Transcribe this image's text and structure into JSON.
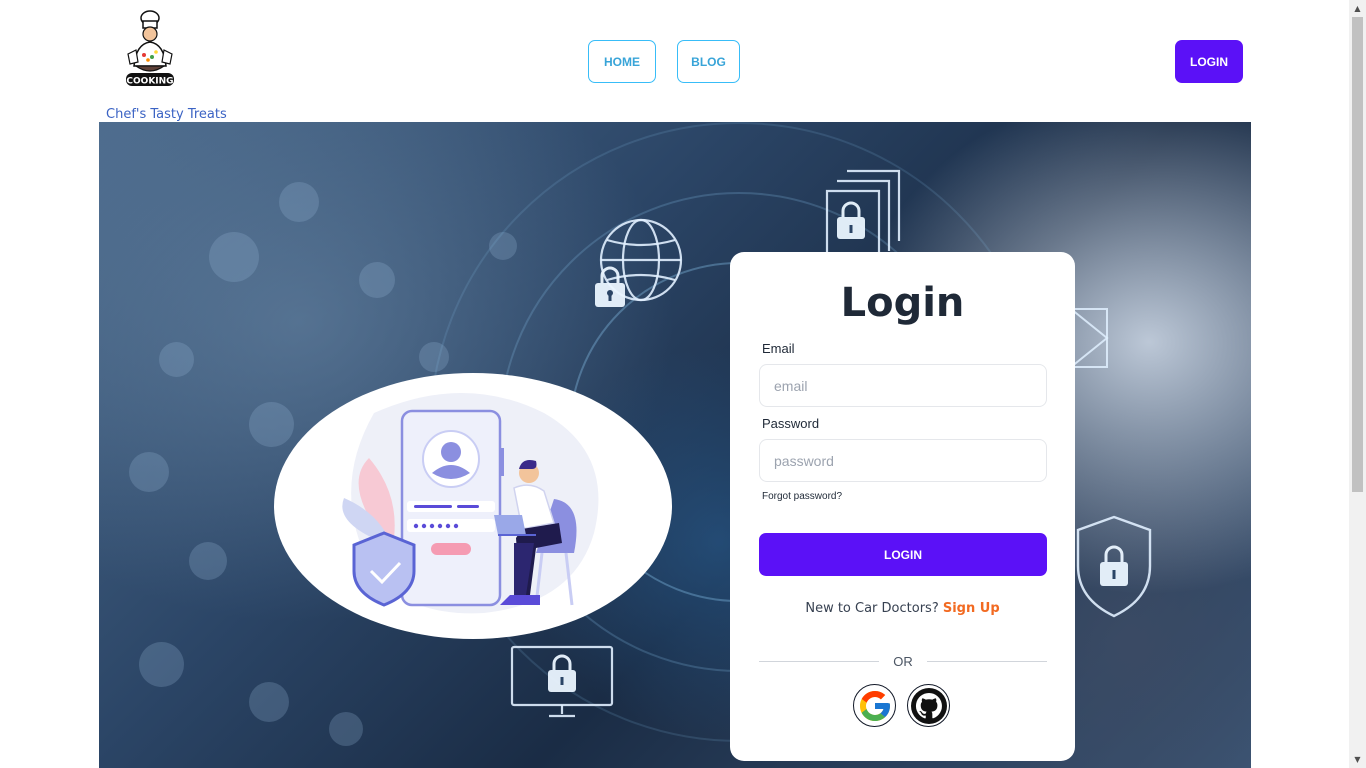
{
  "brand": {
    "name": "Chef's Tasty Treats",
    "logo_text": "COOKING",
    "logo_icon": "chef-logo-icon"
  },
  "nav": {
    "items": [
      {
        "label": "HOME"
      },
      {
        "label": "BLOG"
      }
    ],
    "login_label": "LOGIN"
  },
  "colors": {
    "accent": "#5b11f7",
    "nav_border": "#38bdf8",
    "signup_link": "#f26a21",
    "brand_text": "#3b63c4"
  },
  "login_form": {
    "title": "Login",
    "email": {
      "label": "Email",
      "placeholder": "email",
      "value": ""
    },
    "password": {
      "label": "Password",
      "placeholder": "password",
      "value": ""
    },
    "forgot_password": "Forgot password?",
    "submit_label": "LOGIN",
    "signup_prompt": "New to Car Doctors?",
    "signup_link": "Sign Up",
    "divider_text": "OR",
    "social": [
      {
        "name": "google",
        "icon": "google-icon"
      },
      {
        "name": "github",
        "icon": "github-icon"
      }
    ]
  },
  "hero": {
    "background_icons": [
      "globe-lock-icon",
      "document-lock-icon",
      "mail-icon",
      "monitor-lock-icon",
      "shield-lock-icon"
    ],
    "illustration_icon": "user-login-illustration-icon"
  }
}
